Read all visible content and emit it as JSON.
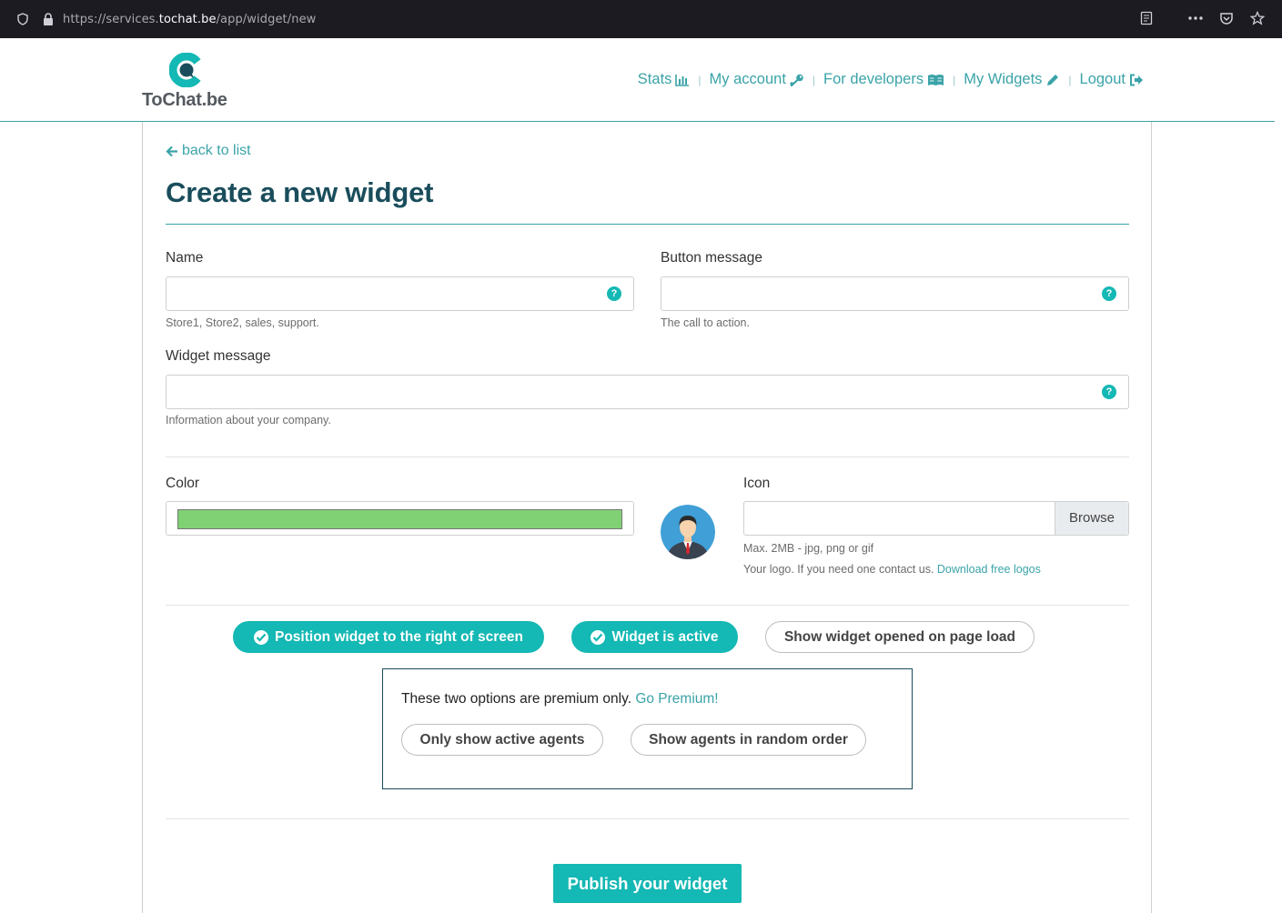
{
  "browser": {
    "url_prefix": "https://services.",
    "url_host": "tochat.be",
    "url_path": "/app/widget/new"
  },
  "header": {
    "logo_text": "ToChat.be",
    "nav": [
      {
        "label": "Stats",
        "icon": "bar-chart-icon"
      },
      {
        "label": "My account",
        "icon": "key-icon"
      },
      {
        "label": "For developers",
        "icon": "book-icon"
      },
      {
        "label": "My Widgets",
        "icon": "pencil-icon"
      },
      {
        "label": "Logout",
        "icon": "sign-out-icon"
      }
    ]
  },
  "page": {
    "back_label": "back to list",
    "title": "Create a new widget"
  },
  "form": {
    "name": {
      "label": "Name",
      "value": "",
      "hint": "Store1, Store2, sales, support."
    },
    "button_message": {
      "label": "Button message",
      "value": "",
      "hint": "The call to action."
    },
    "widget_message": {
      "label": "Widget message",
      "value": "",
      "hint": "Information about your company."
    },
    "color": {
      "label": "Color",
      "value": "#80d174"
    },
    "icon": {
      "label": "Icon",
      "browse_label": "Browse",
      "hint_size": "Max. 2MB - jpg, png or gif",
      "hint_logo": "Your logo. If you need one contact us.",
      "download_link": "Download free logos"
    }
  },
  "toggles": {
    "position_right": {
      "label": "Position widget to the right of screen",
      "on": true
    },
    "active": {
      "label": "Widget is active",
      "on": true
    },
    "opened_on_load": {
      "label": "Show widget opened on page load",
      "on": false
    }
  },
  "premium": {
    "text": "These two options are premium only.",
    "link": "Go Premium!",
    "only_active_agents": "Only show active agents",
    "random_order": "Show agents in random order"
  },
  "publish_label": "Publish your widget",
  "colors": {
    "accent": "#14b8b4",
    "link": "#3aa3a8",
    "title": "#1a4d5c"
  }
}
